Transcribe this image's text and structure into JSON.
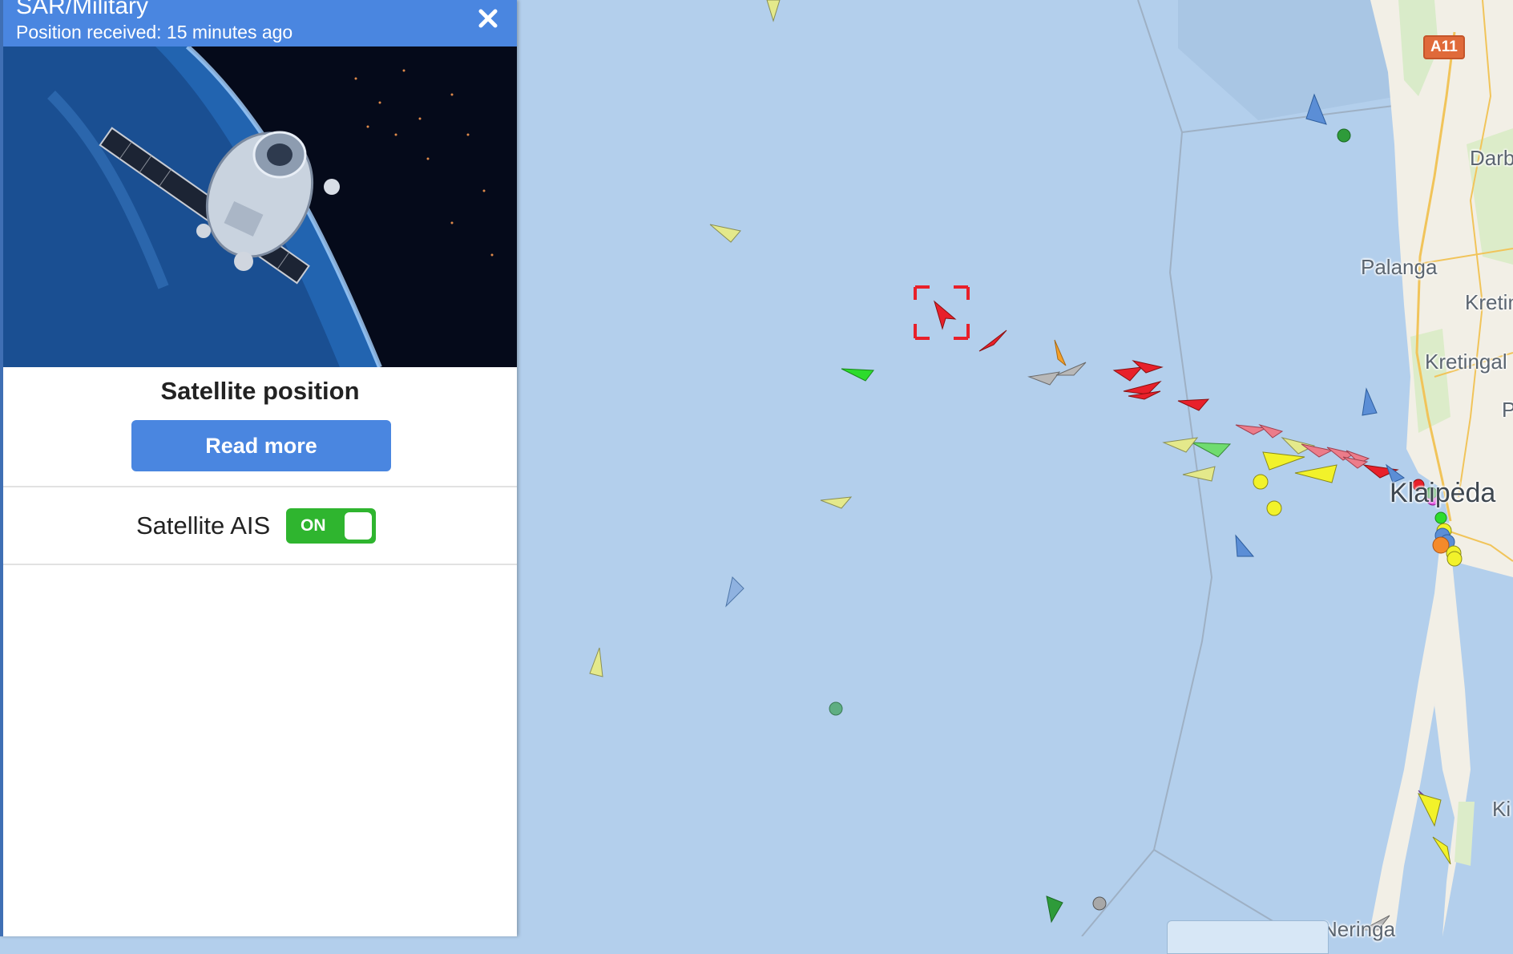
{
  "panel": {
    "title": "SAR/Military",
    "subtitle": "Position received: 15 minutes ago",
    "card_title": "Satellite position",
    "read_more_label": "Read more",
    "satellite_ais_label": "Satellite AIS",
    "satellite_ais_state": "ON",
    "accent_color": "#4a86e0",
    "toggle_color": "#2fb52f"
  },
  "map": {
    "places": {
      "darb": "Darb",
      "palanga": "Palanga",
      "kretin": "Kretin",
      "kretingal": "Kretingal",
      "p": "P",
      "klaipeda": "Klaipėda",
      "ki": "Ki",
      "neringa": "Neringa"
    },
    "road_badge": "A11",
    "water_color": "#b3cfec",
    "land_color": "#f2efe6",
    "selected_marker_color": "#e8202a"
  }
}
